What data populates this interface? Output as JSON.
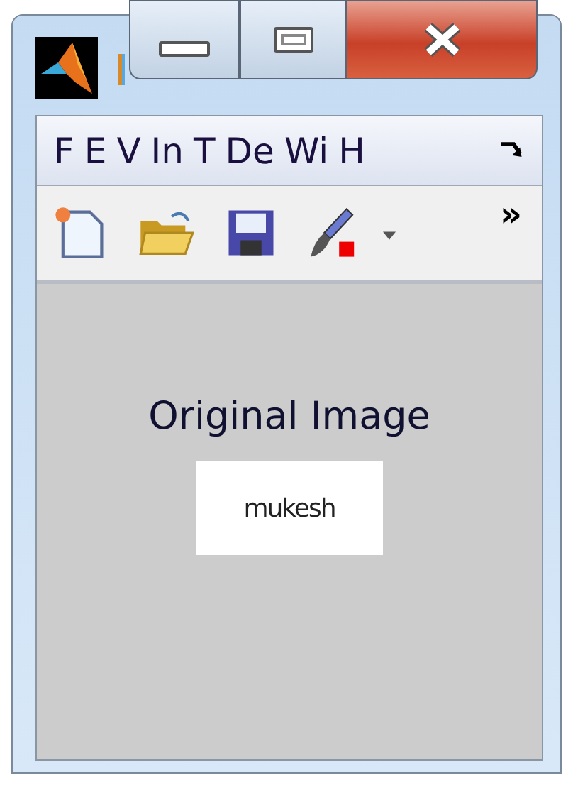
{
  "menu_bar": {
    "items": [
      {
        "label": "F"
      },
      {
        "label": "E"
      },
      {
        "label": "V"
      },
      {
        "label": "In"
      },
      {
        "label": "T"
      },
      {
        "label": "De"
      },
      {
        "label": "Wi"
      },
      {
        "label": "H"
      }
    ]
  },
  "toolbar": {
    "buttons": [
      {
        "kind": "new"
      },
      {
        "kind": "open"
      },
      {
        "kind": "save"
      },
      {
        "kind": "brush",
        "dropdown": true
      }
    ],
    "overflow": "»"
  },
  "figure": {
    "title": "Original Image",
    "image_text": "mukesh"
  }
}
